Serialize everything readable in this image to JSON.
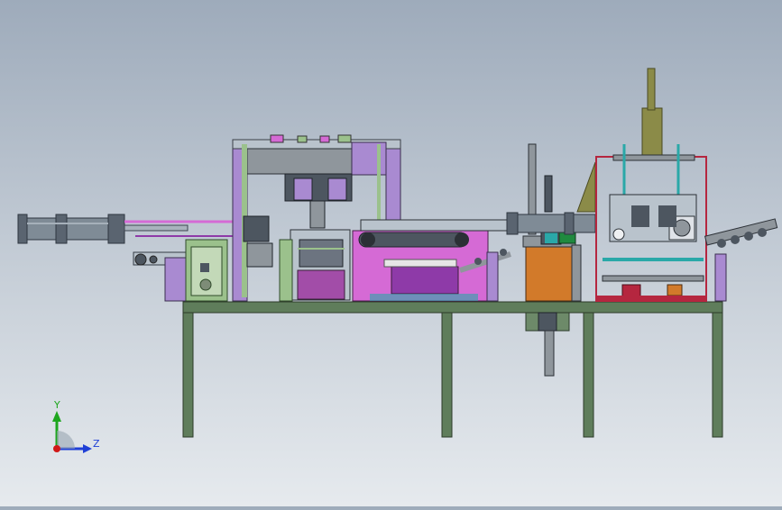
{
  "viewport": {
    "background_top": "#9eabbb",
    "background_bottom": "#e6eaee"
  },
  "triad": {
    "y_label": "Y",
    "z_label": "Z",
    "y_color": "#1ea61e",
    "z_color": "#1f3fd6",
    "x_color": "#d01818"
  },
  "colors": {
    "table": "#5f7d5b",
    "frame_purple": "#a98ad1",
    "frame_green": "#9bc18c",
    "magenta": "#d56ad5",
    "orange": "#d27a2a",
    "steel": "#8f969c",
    "dark_steel": "#4d5660",
    "cylinder": "#7f8b96",
    "olive": "#8b8b48",
    "red_frame": "#b5263f",
    "teal": "#2aa8a8",
    "purple_dark": "#8e3aa8"
  }
}
